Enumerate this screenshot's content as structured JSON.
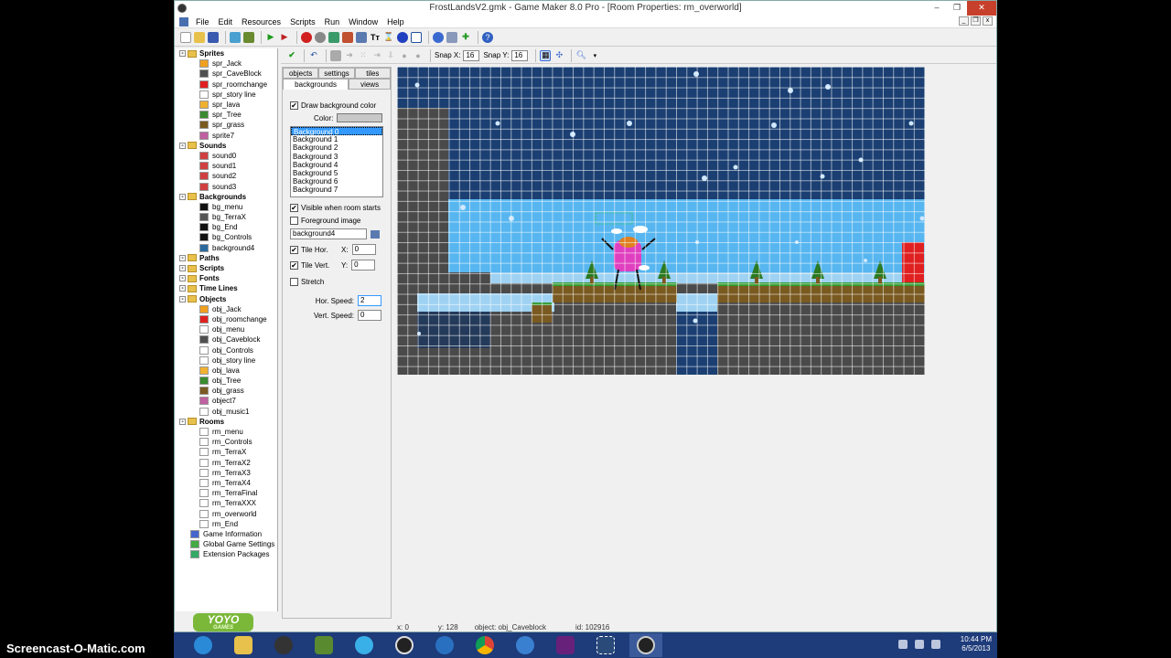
{
  "window": {
    "title": "FrostLandsV2.gmk - Game Maker 8.0 Pro - [Room Properties: rm_overworld]",
    "min": "–",
    "max": "❐",
    "close": "✕"
  },
  "menu": [
    "File",
    "Edit",
    "Resources",
    "Scripts",
    "Run",
    "Window",
    "Help"
  ],
  "toolbar2": {
    "snap_x_label": "Snap X:",
    "snap_x": "16",
    "snap_y_label": "Snap Y:",
    "snap_y": "16"
  },
  "tree": [
    {
      "label": "Sprites",
      "group": true,
      "depth": 0
    },
    {
      "label": "spr_Jack",
      "depth": 1,
      "color": "#f0a020"
    },
    {
      "label": "spr_CaveBlock",
      "depth": 1,
      "color": "#505050"
    },
    {
      "label": "spr_roomchange",
      "depth": 1,
      "color": "#e02020"
    },
    {
      "label": "spr_story line",
      "depth": 1,
      "color": "#ffffff"
    },
    {
      "label": "spr_lava",
      "depth": 1,
      "color": "#f0b030"
    },
    {
      "label": "spr_Tree",
      "depth": 1,
      "color": "#3a8a30"
    },
    {
      "label": "spr_grass",
      "depth": 1,
      "color": "#7a5a20"
    },
    {
      "label": "sprite7",
      "depth": 1,
      "color": "#c060a0"
    },
    {
      "label": "Sounds",
      "group": true,
      "depth": 0
    },
    {
      "label": "sound0",
      "depth": 1,
      "color": "#d04040"
    },
    {
      "label": "sound1",
      "depth": 1,
      "color": "#d04040"
    },
    {
      "label": "sound2",
      "depth": 1,
      "color": "#d04040"
    },
    {
      "label": "sound3",
      "depth": 1,
      "color": "#d04040"
    },
    {
      "label": "Backgrounds",
      "group": true,
      "depth": 0
    },
    {
      "label": "bg_menu",
      "depth": 1,
      "color": "#111111"
    },
    {
      "label": "bg_TerraX",
      "depth": 1,
      "color": "#555555"
    },
    {
      "label": "bg_End",
      "depth": 1,
      "color": "#111111"
    },
    {
      "label": "bg_Controls",
      "depth": 1,
      "color": "#111111"
    },
    {
      "label": "background4",
      "depth": 1,
      "color": "#2a6aa0"
    },
    {
      "label": "Paths",
      "group": true,
      "depth": 0
    },
    {
      "label": "Scripts",
      "group": true,
      "depth": 0
    },
    {
      "label": "Fonts",
      "group": true,
      "depth": 0
    },
    {
      "label": "Time Lines",
      "group": true,
      "depth": 0
    },
    {
      "label": "Objects",
      "group": true,
      "depth": 0
    },
    {
      "label": "obj_Jack",
      "depth": 1,
      "color": "#f0a020"
    },
    {
      "label": "obj_roomchange",
      "depth": 1,
      "color": "#e02020"
    },
    {
      "label": "obj_menu",
      "depth": 1,
      "color": "#ffffff"
    },
    {
      "label": "obj_Caveblock",
      "depth": 1,
      "color": "#505050"
    },
    {
      "label": "obj_Controls",
      "depth": 1,
      "color": "#ffffff"
    },
    {
      "label": "obj_story line",
      "depth": 1,
      "color": "#ffffff"
    },
    {
      "label": "obj_lava",
      "depth": 1,
      "color": "#f0b030"
    },
    {
      "label": "obj_Tree",
      "depth": 1,
      "color": "#3a8a30"
    },
    {
      "label": "obj_grass",
      "depth": 1,
      "color": "#7a5a20"
    },
    {
      "label": "object7",
      "depth": 1,
      "color": "#c060a0"
    },
    {
      "label": "obj_music1",
      "depth": 1,
      "color": "#ffffff"
    },
    {
      "label": "Rooms",
      "group": true,
      "depth": 0
    },
    {
      "label": "rm_menu",
      "depth": 1,
      "color": "#ffffff"
    },
    {
      "label": "rm_Controls",
      "depth": 1,
      "color": "#ffffff"
    },
    {
      "label": "rm_TerraX",
      "depth": 1,
      "color": "#ffffff"
    },
    {
      "label": "rm_TerraX2",
      "depth": 1,
      "color": "#ffffff"
    },
    {
      "label": "rm_TerraX3",
      "depth": 1,
      "color": "#ffffff"
    },
    {
      "label": "rm_TerraX4",
      "depth": 1,
      "color": "#ffffff"
    },
    {
      "label": "rm_TerraFinal",
      "depth": 1,
      "color": "#ffffff"
    },
    {
      "label": "rm_TerraXXX",
      "depth": 1,
      "color": "#ffffff"
    },
    {
      "label": "rm_overworld",
      "depth": 1,
      "color": "#ffffff"
    },
    {
      "label": "rm_End",
      "depth": 1,
      "color": "#ffffff"
    },
    {
      "label": "Game Information",
      "depth": 0,
      "color": "#4466cc"
    },
    {
      "label": "Global Game Settings",
      "depth": 0,
      "color": "#44aa44"
    },
    {
      "label": "Extension Packages",
      "depth": 0,
      "color": "#33aa66"
    }
  ],
  "panel": {
    "tabs_top": [
      "objects",
      "settings",
      "tiles"
    ],
    "tabs_bottom": [
      "backgrounds",
      "views"
    ],
    "draw_bg_color": "Draw background color",
    "color_label": "Color:",
    "bg_items": [
      "Background 0",
      "Background 1",
      "Background 2",
      "Background 3",
      "Background 4",
      "Background 5",
      "Background 6",
      "Background 7"
    ],
    "visible_room_start": "Visible when room starts",
    "foreground_image": "Foreground image",
    "bg_name": "background4",
    "tile_hor": "Tile Hor.",
    "tile_vert": "Tile Vert.",
    "x_label": "X:",
    "x_val": "0",
    "y_label": "Y:",
    "y_val": "0",
    "stretch": "Stretch",
    "hor_speed_label": "Hor. Speed:",
    "hor_speed": "2",
    "vert_speed_label": "Vert. Speed:",
    "vert_speed": "0"
  },
  "status": {
    "x": "x: 0",
    "y": "y: 128",
    "object": "object: obj_Caveblock",
    "id": "id: 102916"
  },
  "tray": {
    "time": "10:44 PM",
    "date": "6/5/2013"
  },
  "watermark": "Screencast-O-Matic.com",
  "yoyo": {
    "title": "YOYO",
    "sub": "GAMES"
  },
  "colors": {
    "sky": "#1b3f72",
    "water": "#57b6f0",
    "light": "#9fd2f2",
    "dirt": "#7a5a20",
    "grass": "#2f9a2f",
    "rock": "#4a4a4a",
    "red": "#e02020",
    "pink": "#e040c0"
  }
}
